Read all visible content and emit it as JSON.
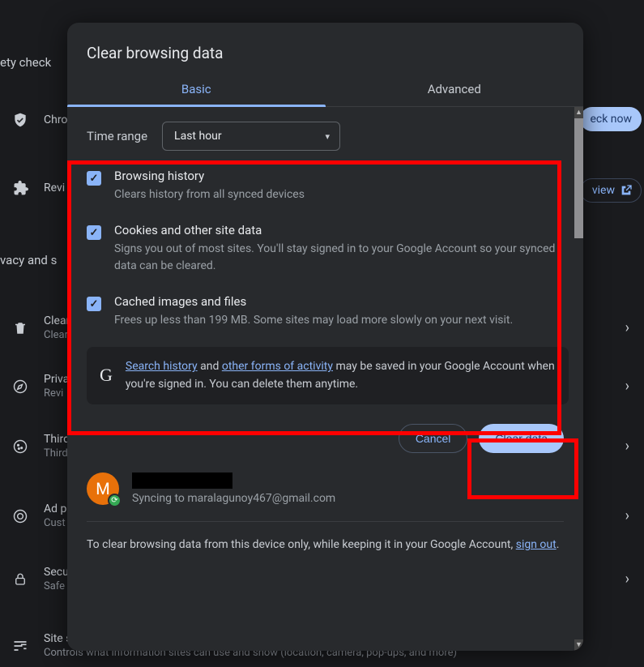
{
  "background": {
    "safety_check": "ety check",
    "chrome_row": "Chro",
    "review_row": "Revi",
    "privacy_section": "vacy and s",
    "check_now": "eck now",
    "view": "view",
    "rows": {
      "clear": {
        "title": "Clear",
        "sub": "Clear"
      },
      "privacy": {
        "title": "Priva",
        "sub": "Revi"
      },
      "third": {
        "title": "Third",
        "sub": "Third"
      },
      "ad": {
        "title": "Ad p",
        "sub": "Cust"
      },
      "security": {
        "title": "Secu",
        "sub": "Safe"
      },
      "site": {
        "title": "Site s",
        "sub": "Controls what information sites can use and show (location, camera, pop-ups, and more)"
      }
    }
  },
  "dialog": {
    "title": "Clear browsing data",
    "tabs": {
      "basic": "Basic",
      "advanced": "Advanced"
    },
    "time_range_label": "Time range",
    "time_range_value": "Last hour",
    "items": [
      {
        "title": "Browsing history",
        "desc": "Clears history from all synced devices"
      },
      {
        "title": "Cookies and other site data",
        "desc": "Signs you out of most sites. You'll stay signed in to your Google Account so your synced data can be cleared."
      },
      {
        "title": "Cached images and files",
        "desc": "Frees up less than 199 MB. Some sites may load more slowly on your next visit."
      }
    ],
    "google_note": {
      "link1": "Search history",
      "mid1": " and ",
      "link2": "other forms of activity",
      "rest": " may be saved in your Google Account when you're signed in. You can delete them anytime."
    },
    "buttons": {
      "cancel": "Cancel",
      "clear": "Clear data"
    },
    "account": {
      "initial": "M",
      "sync_prefix": "Syncing to ",
      "email": "maralagunoy467@gmail.com"
    },
    "footer": {
      "text": "To clear browsing data from this device only, while keeping it in your Google Account, ",
      "link": "sign out",
      "suffix": "."
    }
  }
}
